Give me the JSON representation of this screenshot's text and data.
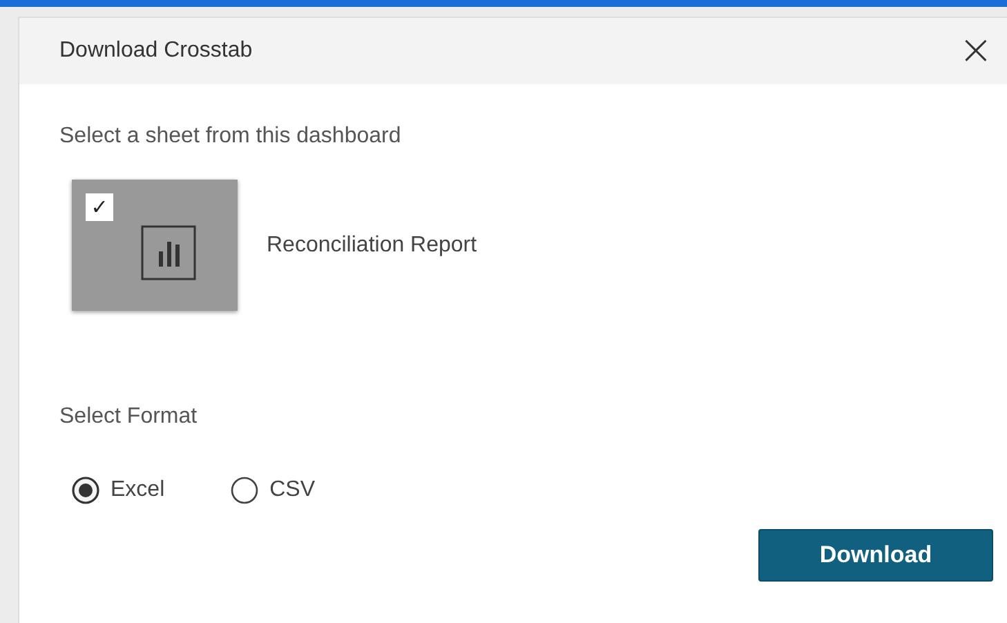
{
  "dialog": {
    "title": "Download Crosstab",
    "close_icon": "×"
  },
  "sheet_section": {
    "label": "Select a sheet from this dashboard",
    "sheets": [
      {
        "name": "Reconciliation Report",
        "checked": true,
        "check": "✓"
      }
    ]
  },
  "format_section": {
    "label": "Select Format",
    "options": [
      {
        "label": "Excel",
        "selected": true
      },
      {
        "label": "CSV",
        "selected": false
      }
    ]
  },
  "buttons": [
    "Download"
  ]
}
